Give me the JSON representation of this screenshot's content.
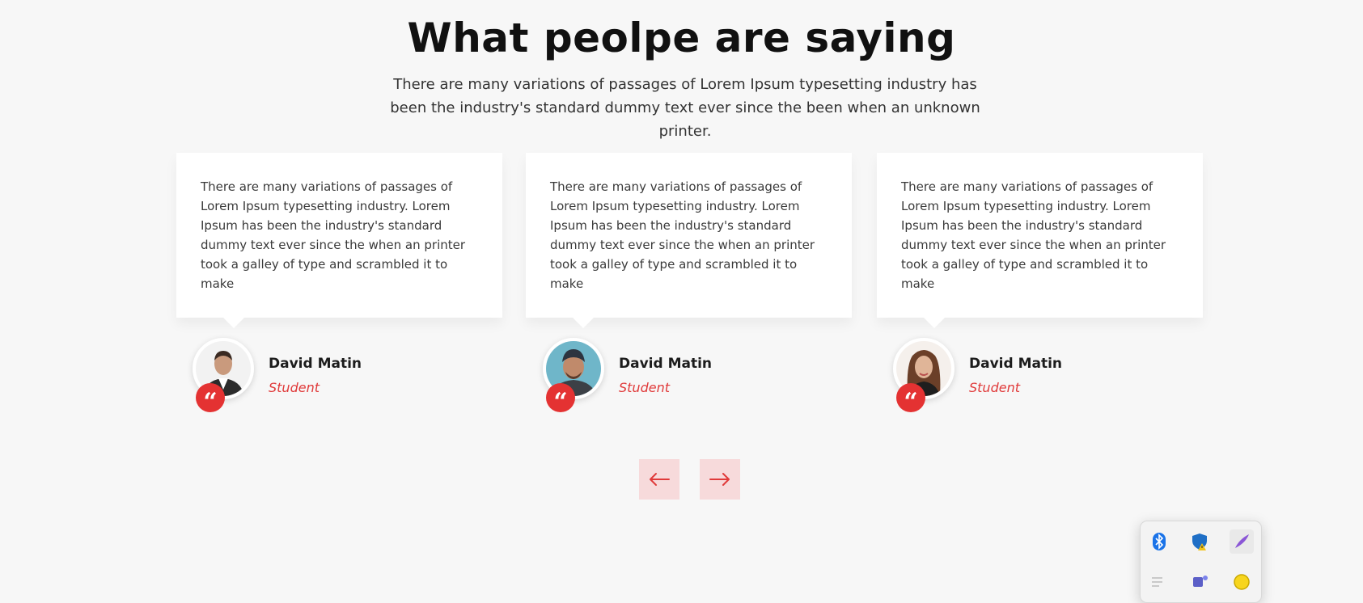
{
  "section": {
    "title": "What peolpe are saying",
    "subtitle": "There are many variations of passages of Lorem Ipsum typesetting industry has been the industry's standard dummy text ever since the been when an unknown printer."
  },
  "testimonials": [
    {
      "text": "There are many variations of passages of Lorem Ipsum typesetting industry. Lorem Ipsum has been the industry's standard dummy text ever since the when an printer took a galley of type and scrambled it to make",
      "name": "David Matin",
      "role": "Student",
      "avatar": "man-suit-avatar"
    },
    {
      "text": "There are many variations of passages of Lorem Ipsum typesetting industry. Lorem Ipsum has been the industry's standard dummy text ever since the when an printer took a galley of type and scrambled it to make",
      "name": "David Matin",
      "role": "Student",
      "avatar": "man-beanie-avatar"
    },
    {
      "text": "There are many variations of passages of Lorem Ipsum typesetting industry. Lorem Ipsum has been the industry's standard dummy text ever since the when an printer took a galley of type and scrambled it to make",
      "name": "David Matin",
      "role": "Student",
      "avatar": "woman-avatar"
    }
  ],
  "quote_icon": "“",
  "navigation": {
    "prev_icon": "arrow-left-icon",
    "next_icon": "arrow-right-icon"
  },
  "system_tray": {
    "icons": [
      "bluetooth-icon",
      "windows-security-warning-icon",
      "pen-feather-icon",
      "list-icon",
      "teams-icon",
      "coin-p-icon"
    ]
  },
  "colors": {
    "accent": "#e43232",
    "role_text": "#e03a3a",
    "nav_button_bg": "#f7dadb",
    "page_bg": "#f7f7f7",
    "card_bg": "#ffffff"
  }
}
